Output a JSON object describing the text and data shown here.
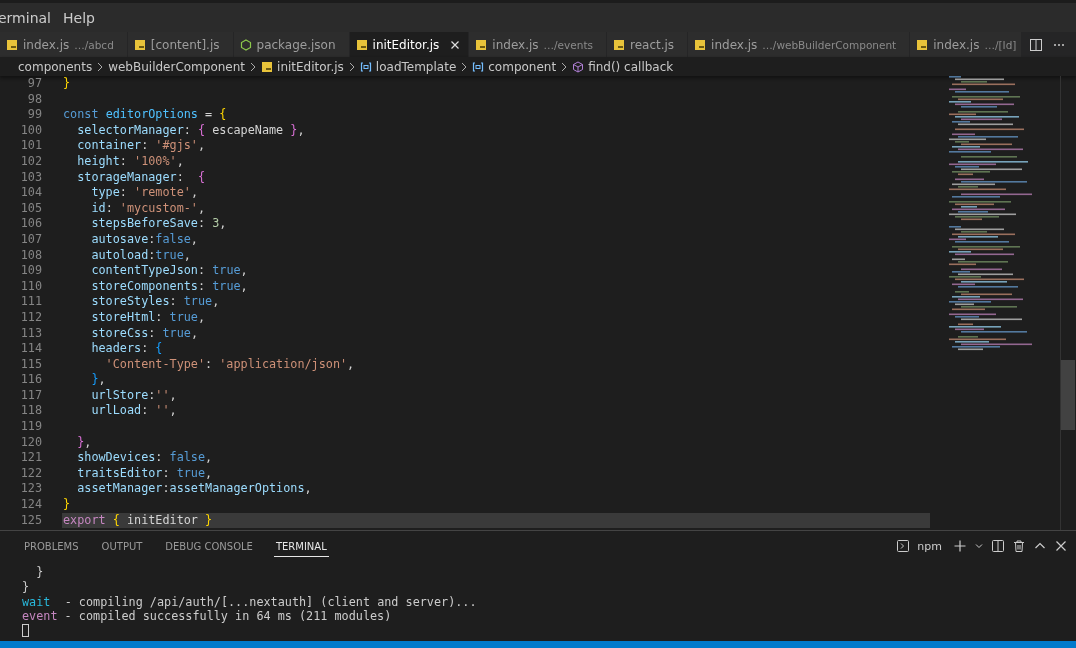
{
  "menu": [
    "erminal",
    "Help"
  ],
  "tabs": [
    {
      "label": "index.js",
      "description": "…/abcd",
      "kind": "js",
      "selected": false
    },
    {
      "label": "[content].js",
      "kind": "js",
      "selected": false
    },
    {
      "label": "package.json",
      "kind": "node",
      "selected": false
    },
    {
      "label": "initEditor.js",
      "kind": "js",
      "selected": true
    },
    {
      "label": "index.js",
      "description": "…/events",
      "kind": "js",
      "selected": false
    },
    {
      "label": "react.js",
      "kind": "js",
      "selected": false
    },
    {
      "label": "index.js",
      "description": "…/webBuilderComponent",
      "kind": "js",
      "selected": false
    },
    {
      "label": "index.js",
      "description": "…/[Id]",
      "kind": "js",
      "selected": false
    }
  ],
  "breadcrumb": [
    {
      "label": "components",
      "kind": "folder"
    },
    {
      "label": "webBuilderComponent",
      "kind": "folder"
    },
    {
      "label": "initEditor.js",
      "kind": "js"
    },
    {
      "label": "loadTemplate",
      "kind": "symbol"
    },
    {
      "label": "component",
      "kind": "symbol"
    },
    {
      "label": "find() callback",
      "kind": "cube"
    }
  ],
  "code": [
    {
      "num": "97",
      "tokens": [
        {
          "kind": "b1",
          "text": "}"
        }
      ]
    },
    {
      "num": "98"
    },
    {
      "num": "99",
      "tokens": [
        {
          "kind": "k",
          "text": "const "
        },
        {
          "kind": "c",
          "text": "editorOptions"
        },
        {
          "kind": "p",
          "text": " = "
        },
        {
          "kind": "b1",
          "text": "{"
        }
      ]
    },
    {
      "num": "100",
      "tokens": [
        {
          "kind": "v",
          "text": "  selectorManager"
        },
        {
          "kind": "p",
          "text": ": "
        },
        {
          "kind": "b2",
          "text": "{"
        },
        {
          "kind": "p",
          "text": " escapeName "
        },
        {
          "kind": "b2",
          "text": "}"
        },
        {
          "kind": "p",
          "text": ","
        }
      ]
    },
    {
      "num": "101",
      "tokens": [
        {
          "kind": "v",
          "text": "  container"
        },
        {
          "kind": "p",
          "text": ": "
        },
        {
          "kind": "s",
          "text": "'#gjs'"
        },
        {
          "kind": "p",
          "text": ","
        }
      ]
    },
    {
      "num": "102",
      "tokens": [
        {
          "kind": "v",
          "text": "  height"
        },
        {
          "kind": "p",
          "text": ": "
        },
        {
          "kind": "s",
          "text": "'100%'"
        },
        {
          "kind": "p",
          "text": ","
        }
      ]
    },
    {
      "num": "103",
      "tokens": [
        {
          "kind": "v",
          "text": "  storageManager"
        },
        {
          "kind": "p",
          "text": ":  "
        },
        {
          "kind": "b2",
          "text": "{"
        }
      ]
    },
    {
      "num": "104",
      "tokens": [
        {
          "kind": "v",
          "text": "    type"
        },
        {
          "kind": "p",
          "text": ": "
        },
        {
          "kind": "s",
          "text": "'remote'"
        },
        {
          "kind": "p",
          "text": ","
        }
      ]
    },
    {
      "num": "105",
      "tokens": [
        {
          "kind": "v",
          "text": "    id"
        },
        {
          "kind": "p",
          "text": ": "
        },
        {
          "kind": "s",
          "text": "'mycustom-'"
        },
        {
          "kind": "p",
          "text": ","
        }
      ]
    },
    {
      "num": "106",
      "tokens": [
        {
          "kind": "v",
          "text": "    stepsBeforeSave"
        },
        {
          "kind": "p",
          "text": ": "
        },
        {
          "kind": "n",
          "text": "3"
        },
        {
          "kind": "p",
          "text": ","
        }
      ]
    },
    {
      "num": "107",
      "tokens": [
        {
          "kind": "v",
          "text": "    autosave"
        },
        {
          "kind": "p",
          "text": ":"
        },
        {
          "kind": "k",
          "text": "false"
        },
        {
          "kind": "p",
          "text": ","
        }
      ]
    },
    {
      "num": "108",
      "tokens": [
        {
          "kind": "v",
          "text": "    autoload"
        },
        {
          "kind": "p",
          "text": ":"
        },
        {
          "kind": "k",
          "text": "true"
        },
        {
          "kind": "p",
          "text": ","
        }
      ]
    },
    {
      "num": "109",
      "tokens": [
        {
          "kind": "v",
          "text": "    contentTypeJson"
        },
        {
          "kind": "p",
          "text": ": "
        },
        {
          "kind": "k",
          "text": "true"
        },
        {
          "kind": "p",
          "text": ","
        }
      ]
    },
    {
      "num": "110",
      "tokens": [
        {
          "kind": "v",
          "text": "    storeComponents"
        },
        {
          "kind": "p",
          "text": ": "
        },
        {
          "kind": "k",
          "text": "true"
        },
        {
          "kind": "p",
          "text": ","
        }
      ]
    },
    {
      "num": "111",
      "tokens": [
        {
          "kind": "v",
          "text": "    storeStyles"
        },
        {
          "kind": "p",
          "text": ": "
        },
        {
          "kind": "k",
          "text": "true"
        },
        {
          "kind": "p",
          "text": ","
        }
      ]
    },
    {
      "num": "112",
      "tokens": [
        {
          "kind": "v",
          "text": "    storeHtml"
        },
        {
          "kind": "p",
          "text": ": "
        },
        {
          "kind": "k",
          "text": "true"
        },
        {
          "kind": "p",
          "text": ","
        }
      ]
    },
    {
      "num": "113",
      "tokens": [
        {
          "kind": "v",
          "text": "    storeCss"
        },
        {
          "kind": "p",
          "text": ": "
        },
        {
          "kind": "k",
          "text": "true"
        },
        {
          "kind": "p",
          "text": ","
        }
      ]
    },
    {
      "num": "114",
      "tokens": [
        {
          "kind": "v",
          "text": "    headers"
        },
        {
          "kind": "p",
          "text": ": "
        },
        {
          "kind": "b3",
          "text": "{"
        }
      ]
    },
    {
      "num": "115",
      "tokens": [
        {
          "kind": "s",
          "text": "      'Content-Type'"
        },
        {
          "kind": "p",
          "text": ": "
        },
        {
          "kind": "s",
          "text": "'application/json'"
        },
        {
          "kind": "p",
          "text": ","
        }
      ]
    },
    {
      "num": "116",
      "tokens": [
        {
          "kind": "b3",
          "text": "    }"
        },
        {
          "kind": "p",
          "text": ","
        }
      ]
    },
    {
      "num": "117",
      "tokens": [
        {
          "kind": "v",
          "text": "    urlStore"
        },
        {
          "kind": "p",
          "text": ":"
        },
        {
          "kind": "s",
          "text": "''"
        },
        {
          "kind": "p",
          "text": ","
        }
      ]
    },
    {
      "num": "118",
      "tokens": [
        {
          "kind": "v",
          "text": "    urlLoad"
        },
        {
          "kind": "p",
          "text": ": "
        },
        {
          "kind": "s",
          "text": "''"
        },
        {
          "kind": "p",
          "text": ","
        }
      ]
    },
    {
      "num": "119"
    },
    {
      "num": "120",
      "tokens": [
        {
          "kind": "b2",
          "text": "  }"
        },
        {
          "kind": "p",
          "text": ","
        }
      ]
    },
    {
      "num": "121",
      "tokens": [
        {
          "kind": "v",
          "text": "  showDevices"
        },
        {
          "kind": "p",
          "text": ": "
        },
        {
          "kind": "k",
          "text": "false"
        },
        {
          "kind": "p",
          "text": ","
        }
      ]
    },
    {
      "num": "122",
      "tokens": [
        {
          "kind": "v",
          "text": "  traitsEditor"
        },
        {
          "kind": "p",
          "text": ": "
        },
        {
          "kind": "k",
          "text": "true"
        },
        {
          "kind": "p",
          "text": ","
        }
      ]
    },
    {
      "num": "123",
      "tokens": [
        {
          "kind": "v",
          "text": "  assetManager"
        },
        {
          "kind": "p",
          "text": ":"
        },
        {
          "kind": "v",
          "text": "assetManagerOptions"
        },
        {
          "kind": "p",
          "text": ","
        }
      ]
    },
    {
      "num": "124",
      "tokens": [
        {
          "kind": "b1",
          "text": "}"
        }
      ]
    },
    {
      "num": "125",
      "highlighted": true,
      "tokens": [
        {
          "kind": "x",
          "text": "export "
        },
        {
          "kind": "b1",
          "text": "{"
        },
        {
          "kind": "p",
          "text": " initEditor "
        },
        {
          "kind": "b1",
          "text": "}"
        }
      ]
    }
  ],
  "panel_tabs": [
    {
      "label": "PROBLEMS",
      "selected": false
    },
    {
      "label": "OUTPUT",
      "selected": false
    },
    {
      "label": "DEBUG CONSOLE",
      "selected": false
    },
    {
      "label": "TERMINAL",
      "selected": true
    }
  ],
  "terminal_name": "npm",
  "terminal": [
    {
      "parts": [
        {
          "kind": "p",
          "text": "  }"
        }
      ]
    },
    {
      "parts": [
        {
          "kind": "p",
          "text": "}"
        }
      ]
    },
    {
      "parts": [
        {
          "kind": "wait",
          "text": "wait"
        },
        {
          "kind": "p",
          "text": "  - compiling /api/auth/[...nextauth] (client and server)..."
        }
      ]
    },
    {
      "parts": [
        {
          "kind": "event",
          "text": "event"
        },
        {
          "kind": "p",
          "text": " - compiled successfully in 64 ms (211 modules)"
        }
      ]
    }
  ]
}
